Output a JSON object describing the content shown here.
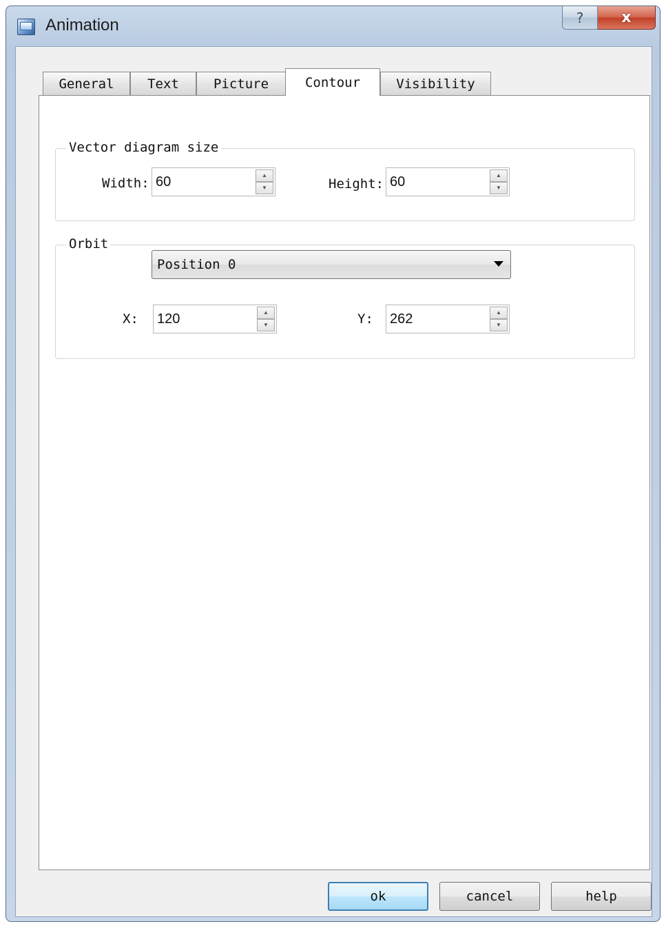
{
  "window": {
    "title": "Animation",
    "help_glyph": "?",
    "close_glyph": "x"
  },
  "tabs": [
    {
      "label": "General",
      "active": false
    },
    {
      "label": "Text",
      "active": false
    },
    {
      "label": "Picture",
      "active": false
    },
    {
      "label": "Contour",
      "active": true
    },
    {
      "label": "Visibility",
      "active": false
    }
  ],
  "vector_diagram": {
    "title": "Vector diagram size",
    "width_label": "Width:",
    "width_value": "60",
    "height_label": "Height:",
    "height_value": "60"
  },
  "orbit": {
    "title": "Orbit",
    "position_selected": "Position 0",
    "x_label": "X:",
    "x_value": "120",
    "y_label": "Y:",
    "y_value": "262"
  },
  "buttons": {
    "ok": "ok",
    "cancel": "cancel",
    "help": "help"
  },
  "icons": {
    "app": "animation-window-icon",
    "spin_up": "spin-up-icon",
    "spin_down": "spin-down-icon",
    "dropdown": "chevron-down-icon"
  }
}
